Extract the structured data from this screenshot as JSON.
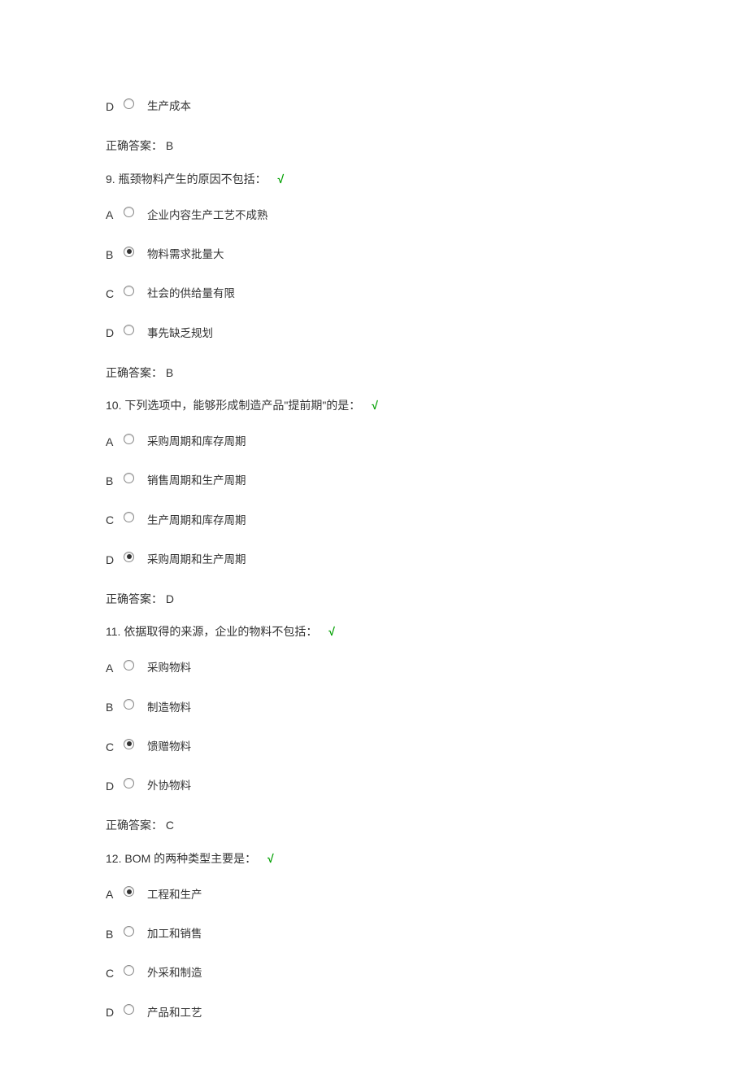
{
  "q8_remainder": {
    "options": [
      {
        "letter": "D",
        "checked": false,
        "text": "生产成本"
      }
    ],
    "answer_label": "正确答案：",
    "answer": "B"
  },
  "q9": {
    "number": "9.",
    "text": "瓶颈物料产生的原因不包括：",
    "check": "√",
    "options": [
      {
        "letter": "A",
        "checked": false,
        "text": "企业内容生产工艺不成熟"
      },
      {
        "letter": "B",
        "checked": true,
        "text": "物料需求批量大"
      },
      {
        "letter": "C",
        "checked": false,
        "text": "社会的供给量有限"
      },
      {
        "letter": "D",
        "checked": false,
        "text": "事先缺乏规划"
      }
    ],
    "answer_label": "正确答案：",
    "answer": "B"
  },
  "q10": {
    "number": "10.",
    "text": "下列选项中，能够形成制造产品\"提前期\"的是：",
    "check": "√",
    "options": [
      {
        "letter": "A",
        "checked": false,
        "text": "采购周期和库存周期"
      },
      {
        "letter": "B",
        "checked": false,
        "text": "销售周期和生产周期"
      },
      {
        "letter": "C",
        "checked": false,
        "text": "生产周期和库存周期"
      },
      {
        "letter": "D",
        "checked": true,
        "text": "采购周期和生产周期"
      }
    ],
    "answer_label": "正确答案：",
    "answer": "D"
  },
  "q11": {
    "number": "11.",
    "text": "依据取得的来源，企业的物料不包括：",
    "check": "√",
    "options": [
      {
        "letter": "A",
        "checked": false,
        "text": "采购物料"
      },
      {
        "letter": "B",
        "checked": false,
        "text": "制造物料"
      },
      {
        "letter": "C",
        "checked": true,
        "text": "馈赠物料"
      },
      {
        "letter": "D",
        "checked": false,
        "text": "外协物料"
      }
    ],
    "answer_label": "正确答案：",
    "answer": "C"
  },
  "q12": {
    "number": "12.",
    "text": "BOM 的两种类型主要是：",
    "check": "√",
    "options": [
      {
        "letter": "A",
        "checked": true,
        "text": "工程和生产"
      },
      {
        "letter": "B",
        "checked": false,
        "text": "加工和销售"
      },
      {
        "letter": "C",
        "checked": false,
        "text": "外采和制造"
      },
      {
        "letter": "D",
        "checked": false,
        "text": "产品和工艺"
      }
    ]
  }
}
